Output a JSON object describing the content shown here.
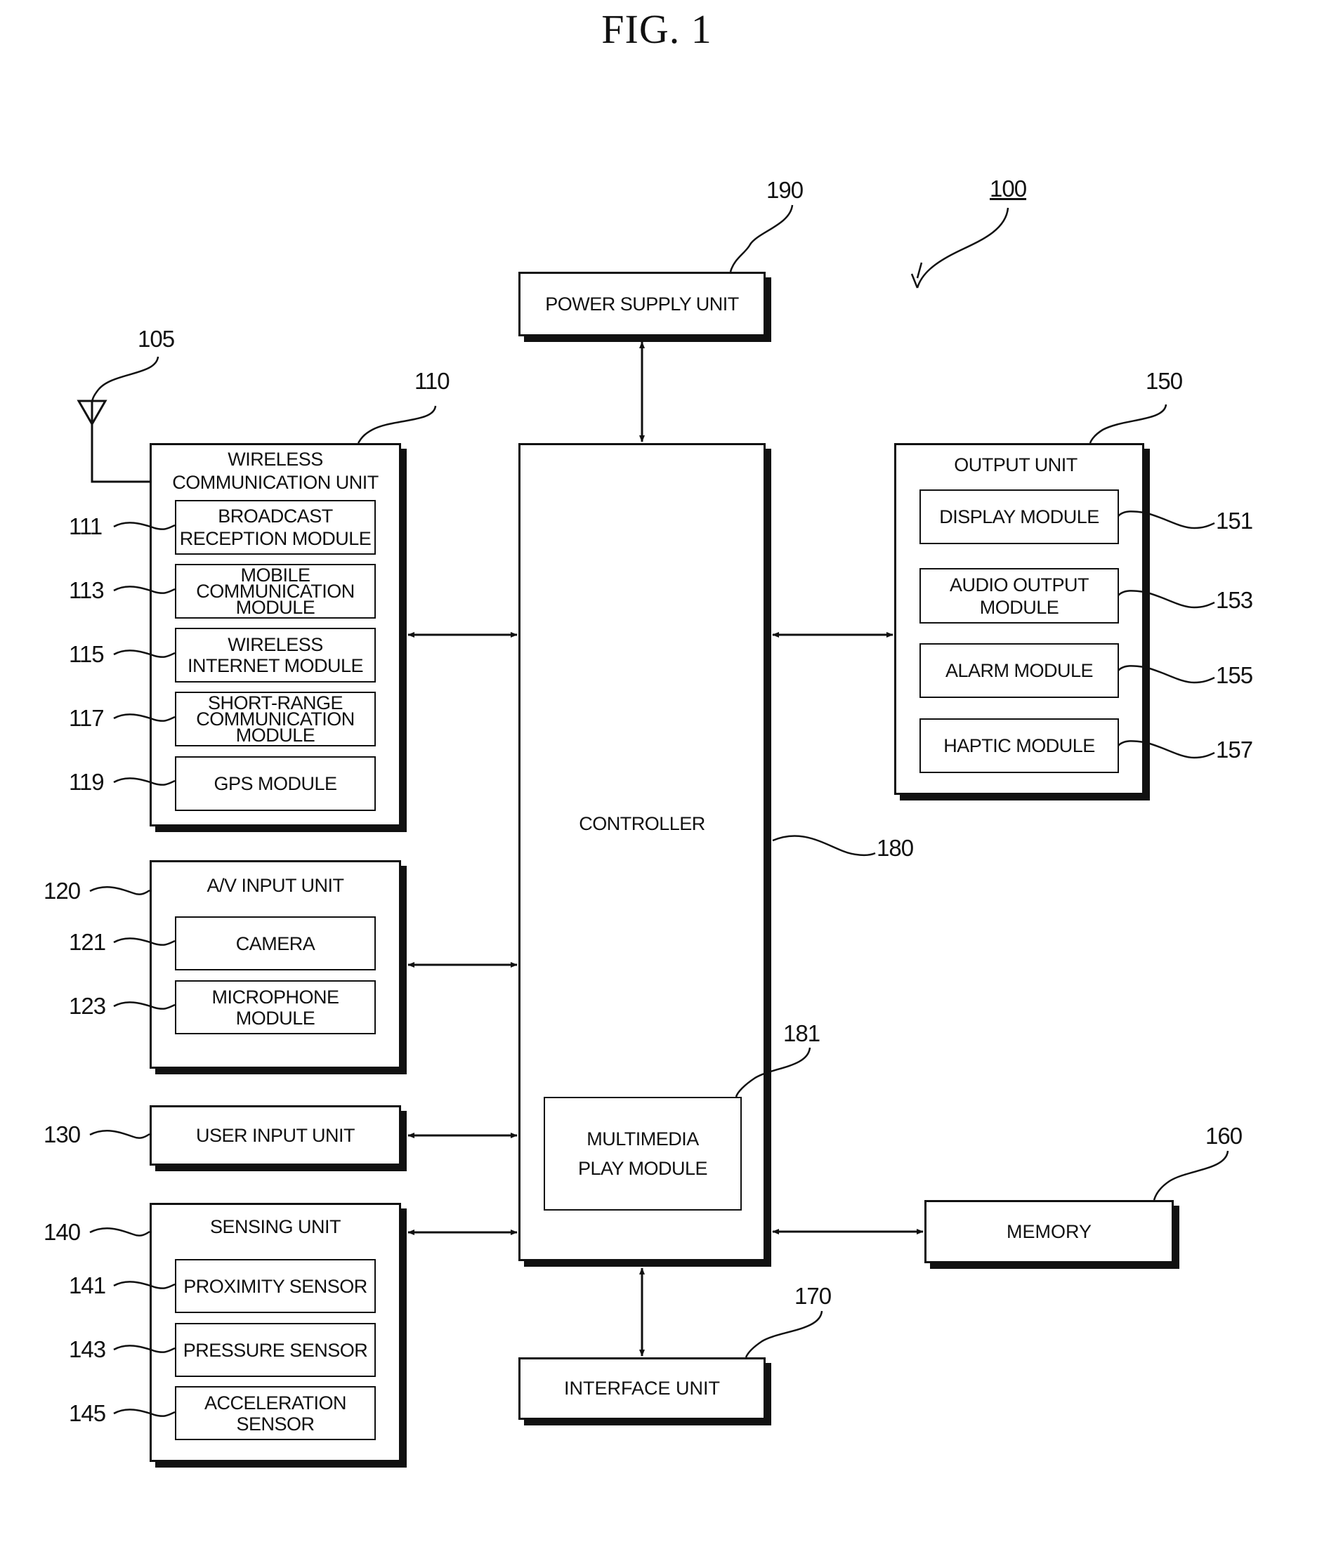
{
  "figure": {
    "title": "FIG. 1"
  },
  "refs": {
    "device": "100",
    "antenna": "105",
    "wireless_unit": "110",
    "broadcast": "111",
    "mobile": "113",
    "internet": "115",
    "short_range": "117",
    "gps": "119",
    "av_unit": "120",
    "camera": "121",
    "microphone": "123",
    "user_input": "130",
    "sensing": "140",
    "proximity": "141",
    "pressure": "143",
    "acceleration": "145",
    "output": "150",
    "display": "151",
    "audio": "153",
    "alarm": "155",
    "haptic": "157",
    "memory": "160",
    "interface": "170",
    "controller": "180",
    "multimedia": "181",
    "power": "190"
  },
  "blocks": {
    "power_supply": "POWER SUPPLY UNIT",
    "controller": "CONTROLLER",
    "multimedia": [
      "MULTIMEDIA",
      "PLAY MODULE"
    ],
    "interface": "INTERFACE UNIT",
    "memory": "MEMORY",
    "wireless": {
      "title": [
        "WIRELESS",
        "COMMUNICATION UNIT"
      ],
      "modules": [
        [
          "BROADCAST",
          "RECEPTION MODULE"
        ],
        [
          "MOBILE",
          "COMMUNICATION",
          "MODULE"
        ],
        [
          "WIRELESS",
          "INTERNET MODULE"
        ],
        [
          "SHORT-RANGE",
          "COMMUNICATION",
          "MODULE"
        ],
        [
          "GPS MODULE"
        ]
      ]
    },
    "av_input": {
      "title": "A/V INPUT UNIT",
      "modules": [
        [
          "CAMERA"
        ],
        [
          "MICROPHONE",
          "MODULE"
        ]
      ]
    },
    "user_input": "USER INPUT UNIT",
    "sensing": {
      "title": "SENSING UNIT",
      "modules": [
        [
          "PROXIMITY SENSOR"
        ],
        [
          "PRESSURE SENSOR"
        ],
        [
          "ACCELERATION",
          "SENSOR"
        ]
      ]
    },
    "output": {
      "title": "OUTPUT UNIT",
      "modules": [
        [
          "DISPLAY MODULE"
        ],
        [
          "AUDIO OUTPUT",
          "MODULE"
        ],
        [
          "ALARM MODULE"
        ],
        [
          "HAPTIC MODULE"
        ]
      ]
    }
  }
}
